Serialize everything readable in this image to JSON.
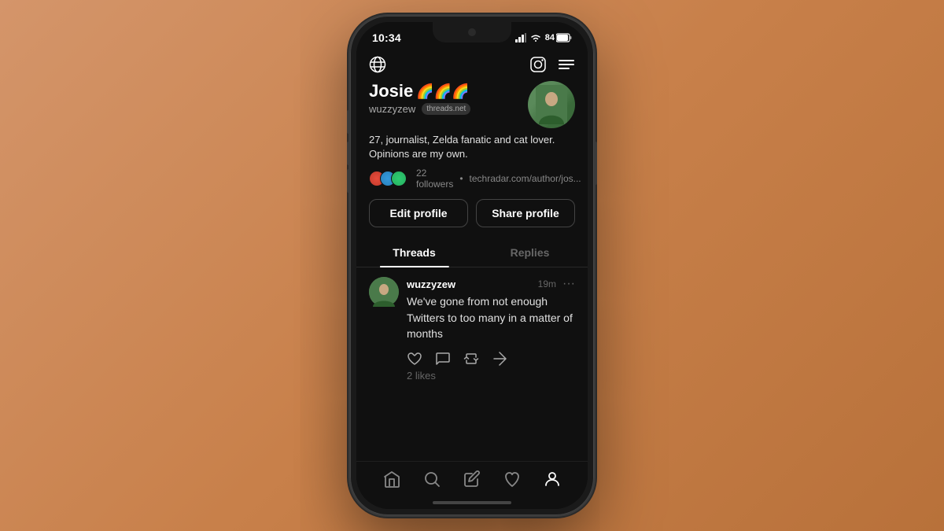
{
  "status_bar": {
    "time": "10:34",
    "battery": "84"
  },
  "top_nav": {
    "globe_icon": "globe-icon",
    "instagram_icon": "instagram-icon",
    "menu_icon": "menu-icon"
  },
  "profile": {
    "name": "Josie",
    "emojis": "🌈🌈🌈",
    "handle": "wuzzyzew",
    "badge": "threads.net",
    "bio_line1": "27, journalist, Zelda fanatic and cat lover.",
    "bio_line2": "Opinions are my own.",
    "followers_count": "22 followers",
    "followers_link": "techradar.com/author/jos...",
    "edit_button": "Edit profile",
    "share_button": "Share profile"
  },
  "tabs": {
    "threads_label": "Threads",
    "replies_label": "Replies"
  },
  "thread": {
    "username": "wuzzyzew",
    "time": "19m",
    "text": "We've gone from not enough Twitters to too many in a matter of months",
    "likes": "2 likes"
  },
  "bottom_nav": {
    "home": "home-icon",
    "search": "search-icon",
    "compose": "compose-icon",
    "heart": "heart-icon",
    "profile": "profile-icon"
  }
}
